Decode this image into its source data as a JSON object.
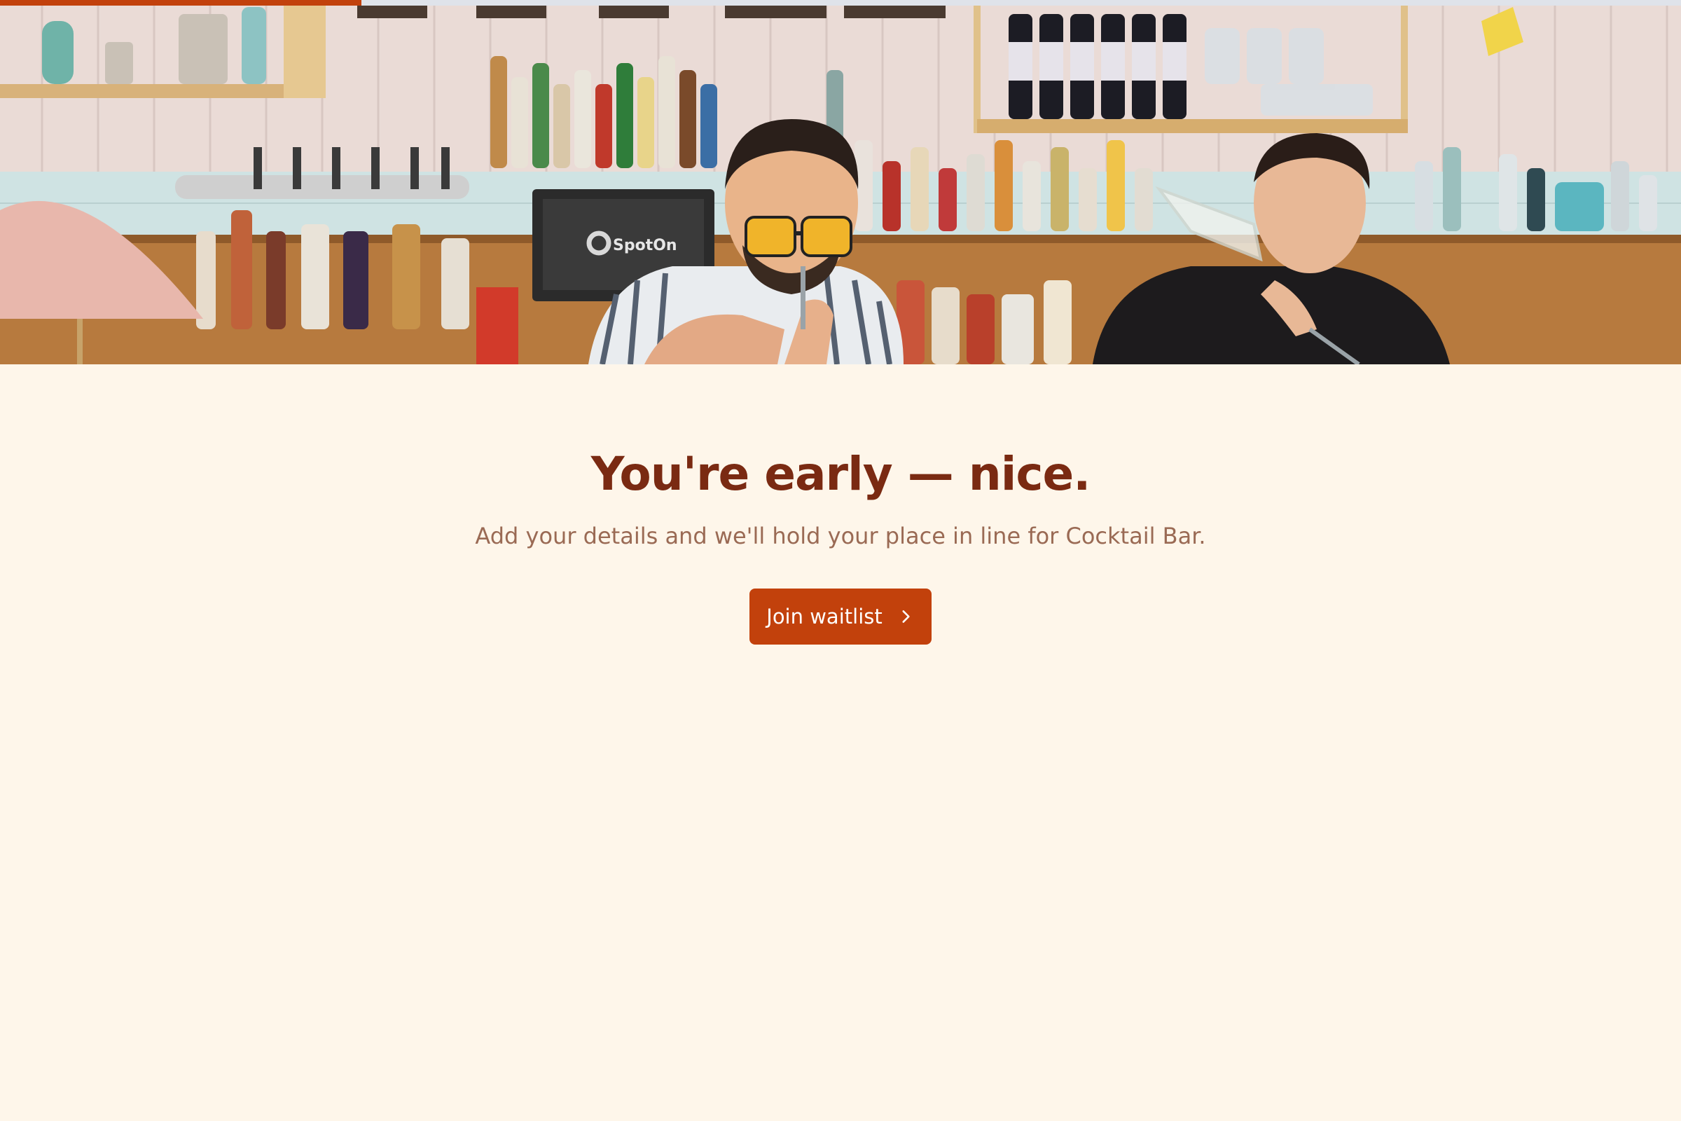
{
  "progress": {
    "fraction": 0.215,
    "color": "#c2410c"
  },
  "hero": {
    "image_alt": "Two bartenders working behind a bar with shelves of bottles",
    "pos_logo_text": "SpotOn"
  },
  "main": {
    "headline": "You're early — nice.",
    "subheadline": "Add your details and we'll hold your place in line for Cocktail Bar.",
    "join_button_label": "Join waitlist",
    "join_button_icon": "chevron-right-icon"
  },
  "colors": {
    "background": "#fef6ea",
    "headline": "#7a2a12",
    "subheadline": "#9a6a54",
    "accent": "#c2410c"
  }
}
